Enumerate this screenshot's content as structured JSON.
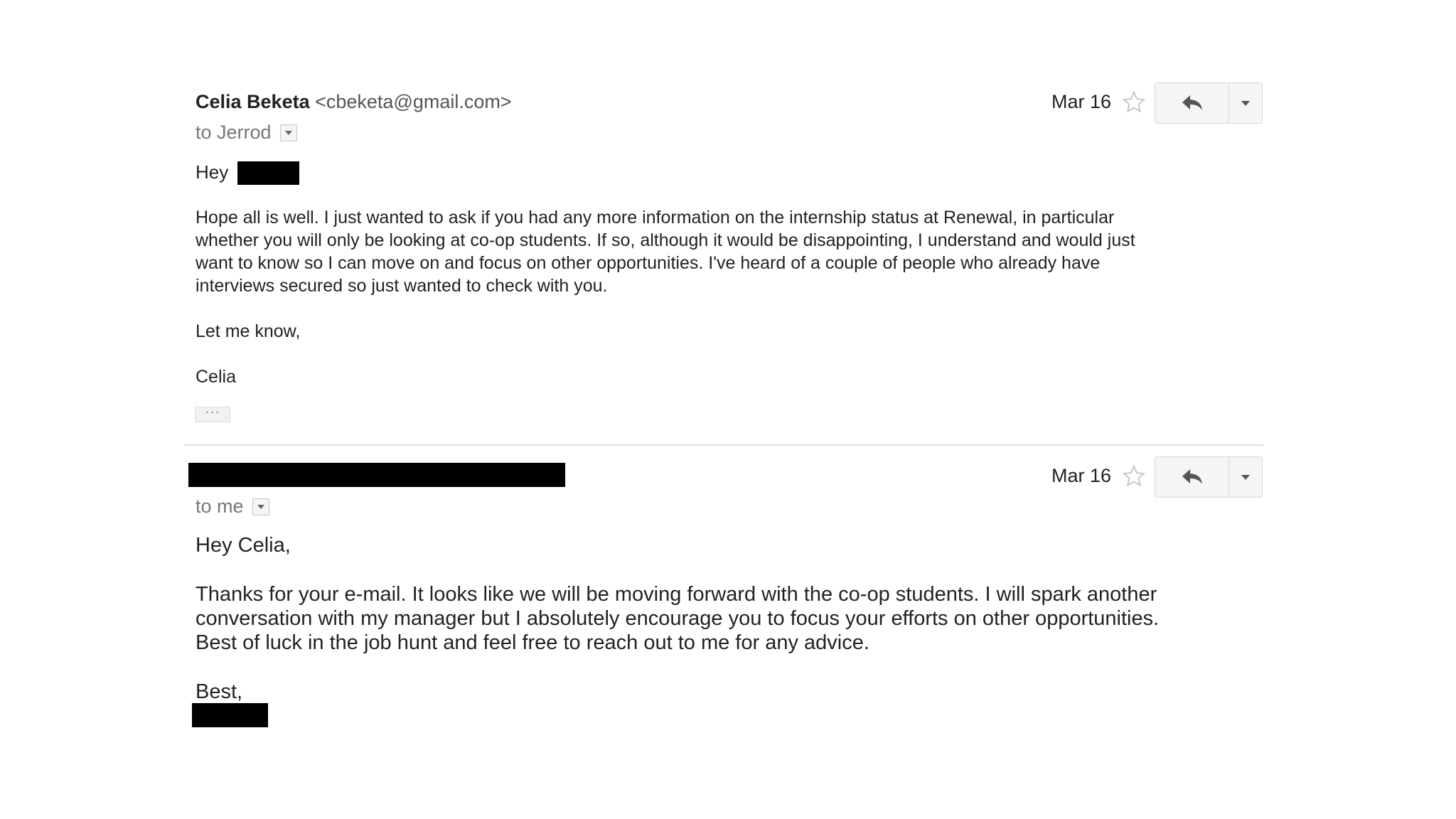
{
  "message1": {
    "sender_name": "Celia Beketa",
    "sender_email": "<cbeketa@gmail.com>",
    "to_line": "to Jerrod",
    "date": "Mar 16",
    "body": {
      "greeting": "Hey",
      "paragraph_lines": [
        "Hope all is well. I just wanted to ask if you had any more information on the internship status at Renewal, in particular",
        "whether you will only be looking at co-op students. If so, although it would be disappointing, I understand and would just",
        "want to know so I can move on and focus on other opportunities. I've heard of a couple of people who already have",
        "interviews secured so just wanted to check with you."
      ],
      "closing": "Let me know,",
      "signature": "Celia"
    },
    "show_trimmed_label": "···"
  },
  "message2": {
    "to_line": "to me",
    "date": "Mar 16",
    "body": {
      "greeting": "Hey Celia,",
      "paragraph_lines": [
        "Thanks for your e-mail. It looks like we will be moving forward with the co-op students. I will spark another",
        "conversation with my manager but I absolutely encourage you to focus your efforts on other opportunities.",
        "Best of luck in the job hunt and feel free to reach out to me for any advice."
      ],
      "closing": "Best,"
    }
  },
  "icons": {
    "star": "star-outline-icon",
    "reply": "reply-arrow-icon",
    "more": "caret-down-icon",
    "recipients_dropdown": "caret-down-icon"
  },
  "colors": {
    "redaction": "#000000",
    "button_bg": "#f5f5f5",
    "button_border": "#d8d8d8",
    "meta_text": "#777777"
  }
}
